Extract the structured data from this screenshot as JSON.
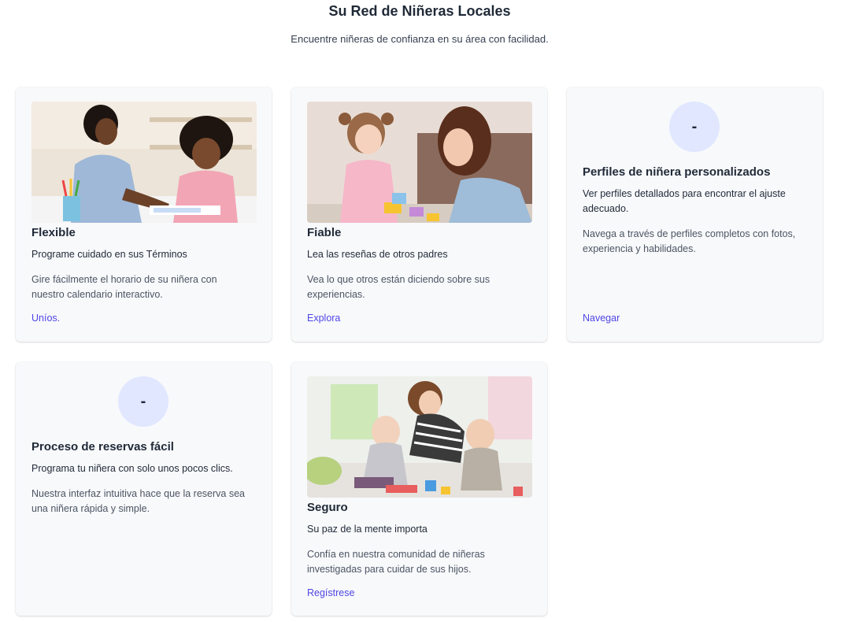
{
  "header": {
    "title": "Su Red de Niñeras Locales",
    "subtitle": "Encuentre niñeras de confianza en su área con facilidad."
  },
  "cards": [
    {
      "title": "Flexible",
      "lead": "Programe cuidado en sus Términos",
      "description": "Gire fácilmente el horario de su niñera con nuestro calendario interactivo.",
      "link": "Uníos."
    },
    {
      "title": "Fiable",
      "lead": "Lea las reseñas de otros padres",
      "description": "Vea lo que otros están diciendo sobre sus experiencias.",
      "link": "Explora"
    },
    {
      "icon_text": "-",
      "title": "Perfiles de niñera personalizados",
      "lead": "Ver perfiles detallados para encontrar el ajuste adecuado.",
      "description": "Navega a través de perfiles completos con fotos, experiencia y habilidades.",
      "link": "Navegar"
    },
    {
      "icon_text": "-",
      "title": "Proceso de reservas fácil",
      "lead": "Programa tu niñera con solo unos pocos clics.",
      "description": "Nuestra interfaz intuitiva hace que la reserva sea una niñera rápida y simple."
    },
    {
      "title": "Seguro",
      "lead": "Su paz de la mente importa",
      "description": "Confía en nuestra comunidad de niñeras investigadas para cuidar de sus hijos.",
      "link": "Regístrese"
    }
  ]
}
